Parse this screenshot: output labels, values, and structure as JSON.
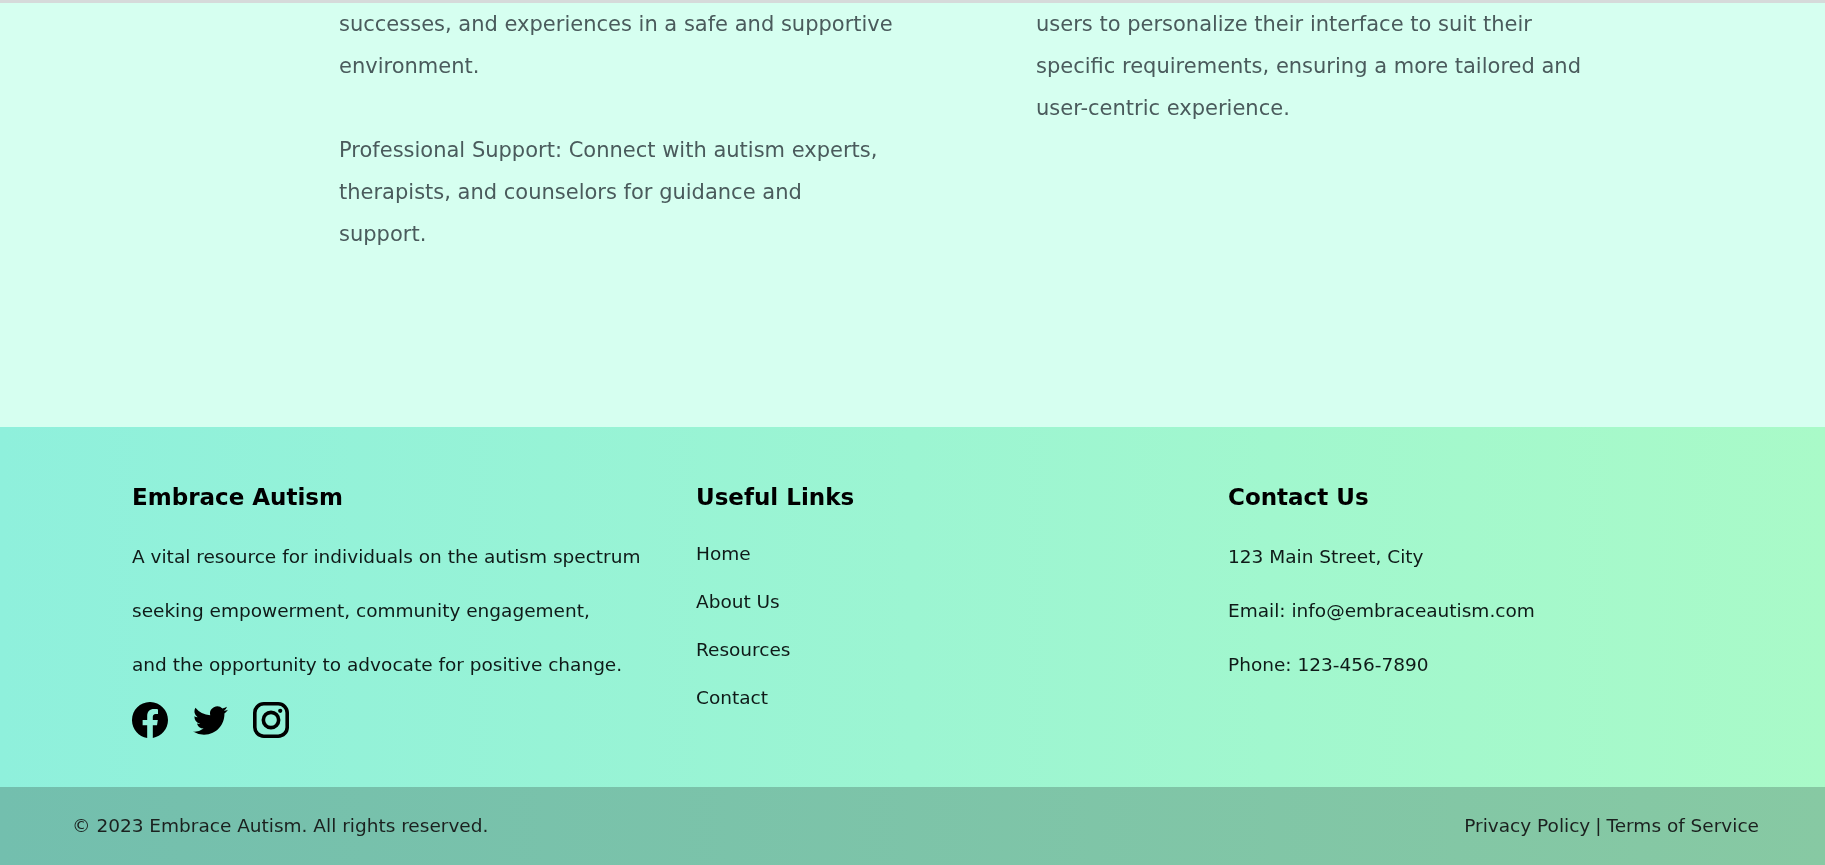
{
  "content": {
    "columns": [
      {
        "paragraphs": [
          "successes, and experiences in a safe and supportive\nenvironment.",
          "Professional Support: Connect with autism experts,\ntherapists, and counselors for guidance and\nsupport."
        ]
      },
      {
        "paragraphs": [
          "users to personalize their interface to suit their\nspecific requirements, ensuring a more tailored and\nuser-centric experience."
        ]
      }
    ]
  },
  "footer": {
    "about": {
      "title": "Embrace Autism",
      "description": "A vital resource for individuals on the autism spectrum\nseeking empowerment, community engagement,\nand the opportunity to advocate for positive change.",
      "social_links": [
        {
          "kind": "facebook"
        },
        {
          "kind": "twitter"
        },
        {
          "kind": "instagram"
        }
      ]
    },
    "links": {
      "title": "Useful Links",
      "items": [
        "Home",
        "About Us",
        "Resources",
        "Contact"
      ]
    },
    "contact": {
      "title": "Contact Us",
      "lines": [
        "123 Main Street, City",
        "Email: info@embraceautism.com",
        "Phone: 123-456-7890"
      ]
    }
  },
  "bottom_bar": {
    "copyright": "© 2023 Embrace Autism. All rights reserved.",
    "legal_links": [
      "Privacy Policy",
      "Terms of Service"
    ],
    "separator": "|"
  }
}
